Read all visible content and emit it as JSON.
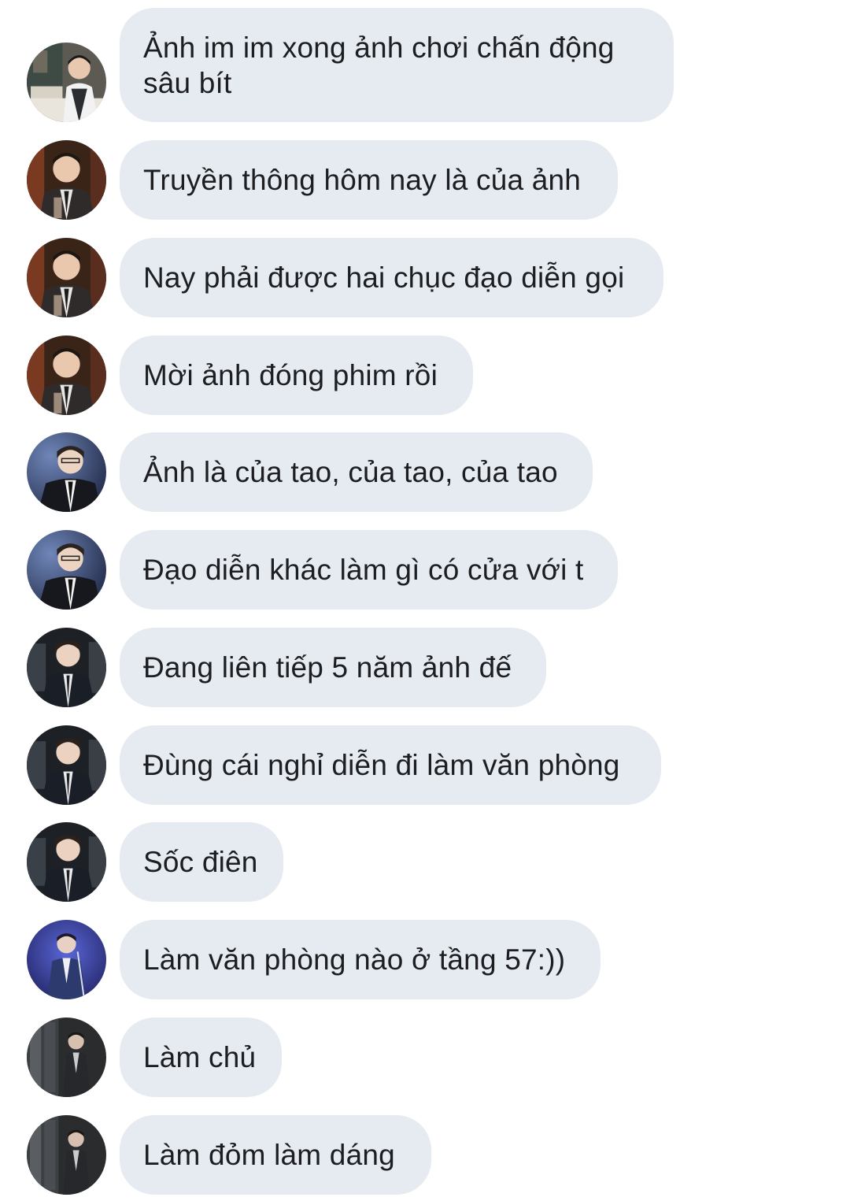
{
  "conversation": {
    "messages": [
      {
        "avatar": "avatar-a",
        "text": "Ảnh im im xong ảnh chơi chấn động sâu bít"
      },
      {
        "avatar": "avatar-b",
        "text": "Truyền thông hôm nay là của ảnh"
      },
      {
        "avatar": "avatar-b",
        "text": "Nay phải được hai chục đạo diễn gọi"
      },
      {
        "avatar": "avatar-b",
        "text": "Mời ảnh đóng phim rồi"
      },
      {
        "avatar": "avatar-c",
        "text": "Ảnh là của tao, của tao, của tao"
      },
      {
        "avatar": "avatar-c",
        "text": "Đạo diễn khác làm gì có cửa với t"
      },
      {
        "avatar": "avatar-d",
        "text": "Đang liên tiếp 5 năm ảnh đế"
      },
      {
        "avatar": "avatar-d",
        "text": "Đùng cái nghỉ diễn đi làm văn phòng"
      },
      {
        "avatar": "avatar-d",
        "text": "Sốc điên"
      },
      {
        "avatar": "avatar-e",
        "text": "Làm văn phòng nào ở tầng 57:))"
      },
      {
        "avatar": "avatar-f",
        "text": "Làm chủ"
      },
      {
        "avatar": "avatar-f",
        "text": "Làm đỏm làm dáng"
      }
    ]
  },
  "colors": {
    "bubble_background": "#e6ebf1",
    "text": "#1c1e21",
    "page_background": "#ffffff"
  }
}
